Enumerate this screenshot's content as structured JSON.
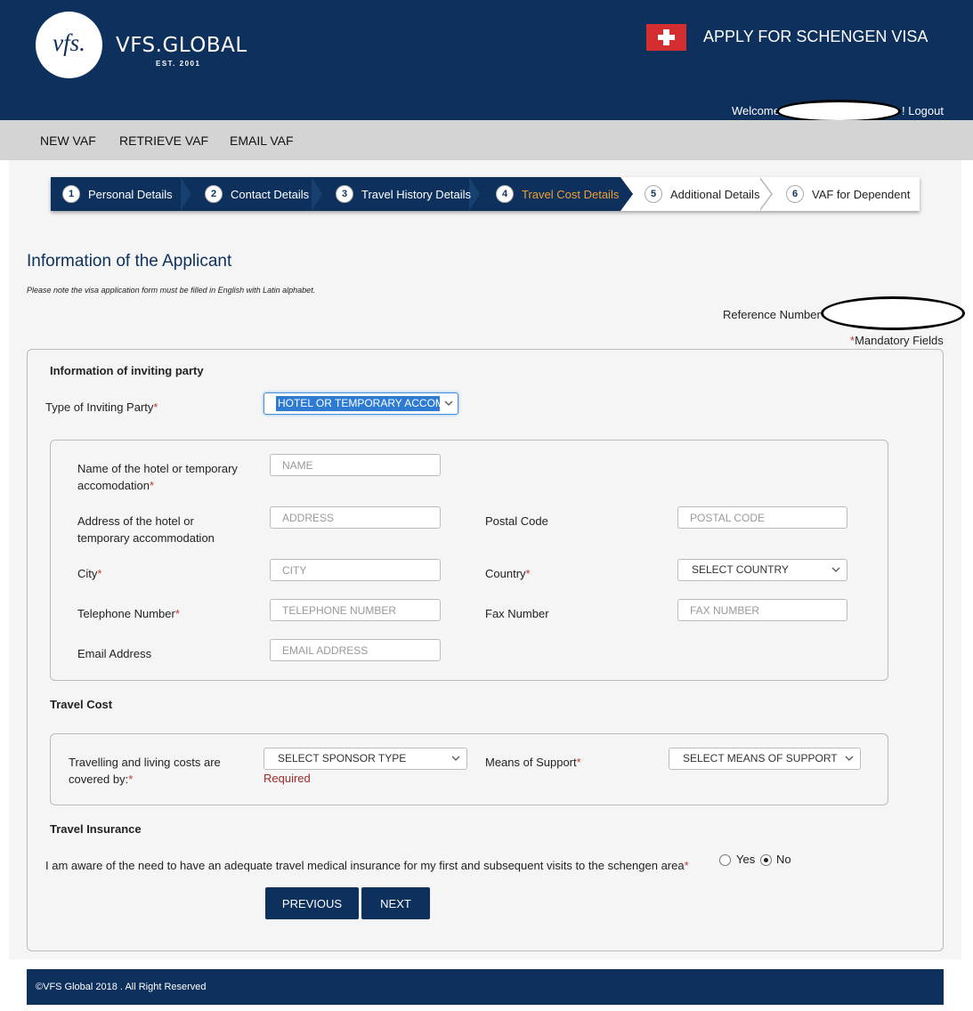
{
  "header": {
    "logo_text": "vfs.",
    "brand": "VFS.GLOBAL",
    "brand_sub": "EST. 2001",
    "title": "APPLY FOR SCHENGEN VISA",
    "welcome": "Welcome",
    "logout": "! Logout",
    "colors": {
      "header_bg": "#0d305c",
      "flag_red": "#d42e30"
    }
  },
  "nav": {
    "items": [
      "NEW VAF",
      "RETRIEVE VAF",
      "EMAIL VAF"
    ]
  },
  "stepper": {
    "steps": [
      {
        "num": "1",
        "label": "Personal Details"
      },
      {
        "num": "2",
        "label": "Contact Details"
      },
      {
        "num": "3",
        "label": "Travel History Details"
      },
      {
        "num": "4",
        "label": "Travel Cost Details"
      },
      {
        "num": "5",
        "label": "Additional Details"
      },
      {
        "num": "6",
        "label": "VAF for Dependent"
      }
    ],
    "active_step": 4,
    "active_color": "#f0a030"
  },
  "page": {
    "title": "Information of the Applicant",
    "note": "Please note the visa application form must be filled in English with Latin alphabet.",
    "reference_label": "Reference Number",
    "mandatory_star": "*",
    "mandatory_label": "Mandatory Fields"
  },
  "inviting": {
    "section_title": "Information of inviting party",
    "type_label": "Type of Inviting Party",
    "type_value": "HOTEL OR TEMPORARY ACCOMMODATION",
    "fields": {
      "name_label_1": "Name of the hotel or temporary",
      "name_label_2": "accomodation",
      "name_placeholder": "NAME",
      "address_label_1": "Address of the hotel or",
      "address_label_2": "temporary accommodation",
      "address_placeholder": "ADDRESS",
      "postal_label": "Postal Code",
      "postal_placeholder": "POSTAL CODE",
      "city_label": "City",
      "city_placeholder": "CITY",
      "country_label": "Country",
      "country_value": "SELECT COUNTRY",
      "phone_label": "Telephone Number",
      "phone_placeholder": "TELEPHONE NUMBER",
      "fax_label": "Fax Number",
      "fax_placeholder": "FAX NUMBER",
      "email_label": "Email Address",
      "email_placeholder": "EMAIL ADDRESS"
    }
  },
  "travel_cost": {
    "section_title": "Travel Cost",
    "covered_label_1": "Travelling and living costs are",
    "covered_label_2": "covered by:",
    "sponsor_value": "SELECT SPONSOR TYPE",
    "required_msg": "Required",
    "support_label": "Means of Support",
    "support_value": "SELECT MEANS OF SUPPORT"
  },
  "insurance": {
    "section_title": "Travel Insurance",
    "question": "I am aware of the need to have an adequate travel medical insurance for my first and subsequent visits to the schengen area",
    "yes_label": "Yes",
    "no_label": "No",
    "selected": "No"
  },
  "buttons": {
    "previous": "PREVIOUS",
    "next": "NEXT"
  },
  "footer": {
    "text": "©VFS Global 2018 . All Right Reserved"
  }
}
